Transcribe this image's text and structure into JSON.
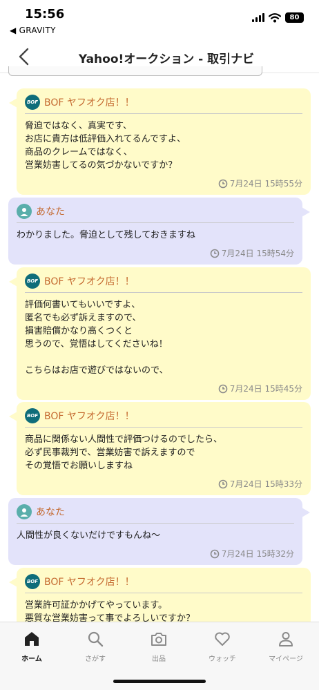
{
  "status_bar": {
    "time": "15:56",
    "back_app": "◀ GRAVITY",
    "battery": "80"
  },
  "header": {
    "title": "Yahoo!オークション - 取引ナビ"
  },
  "messages": [
    {
      "sender": "BOF ヤフオク店！！",
      "avatar_text": "BOF",
      "lines": [
        "脅迫ではなく、真実です、",
        "お店に貴方は低評価入れてるんですよ、",
        "商品のクレームではなく、",
        "営業妨害してるの気づかないですか？"
      ],
      "time": "7月24日 15時55分"
    },
    {
      "sender": "あなた",
      "lines": [
        "わかりました。脅迫として残しておきますね"
      ],
      "time": "7月24日 15時54分"
    },
    {
      "sender": "BOF ヤフオク店！！",
      "avatar_text": "BOF",
      "lines": [
        "評価何書いてもいいですよ、",
        "匿名でも必ず訴えますので、",
        "損害賠償かなり高くつくと",
        "思うので、覚悟はしてくださいね！",
        "",
        "こちらはお店で遊びではないので、"
      ],
      "time": "7月24日 15時45分"
    },
    {
      "sender": "BOF ヤフオク店！！",
      "avatar_text": "BOF",
      "lines": [
        "商品に関係ない人間性で評価つけるのでしたら、",
        "必ず民事裁判で、営業妨害で訴えますので",
        "その覚悟でお願いしますね"
      ],
      "time": "7月24日 15時33分"
    },
    {
      "sender": "あなた",
      "lines": [
        "人間性が良くないだけですもんね〜"
      ],
      "time": "7月24日 15時32分"
    },
    {
      "sender": "BOF ヤフオク店！！",
      "avatar_text": "BOF",
      "lines": [
        "営業許可証かかげてやっています。",
        "悪質な営業妨害って事でよろしいですか？"
      ],
      "time": ""
    }
  ],
  "tab_bar": {
    "tabs": [
      {
        "label": "ホーム",
        "icon": "home-icon"
      },
      {
        "label": "さがす",
        "icon": "search-icon"
      },
      {
        "label": "出品",
        "icon": "camera-icon"
      },
      {
        "label": "ウォッチ",
        "icon": "heart-icon"
      },
      {
        "label": "マイページ",
        "icon": "person-icon"
      }
    ]
  }
}
